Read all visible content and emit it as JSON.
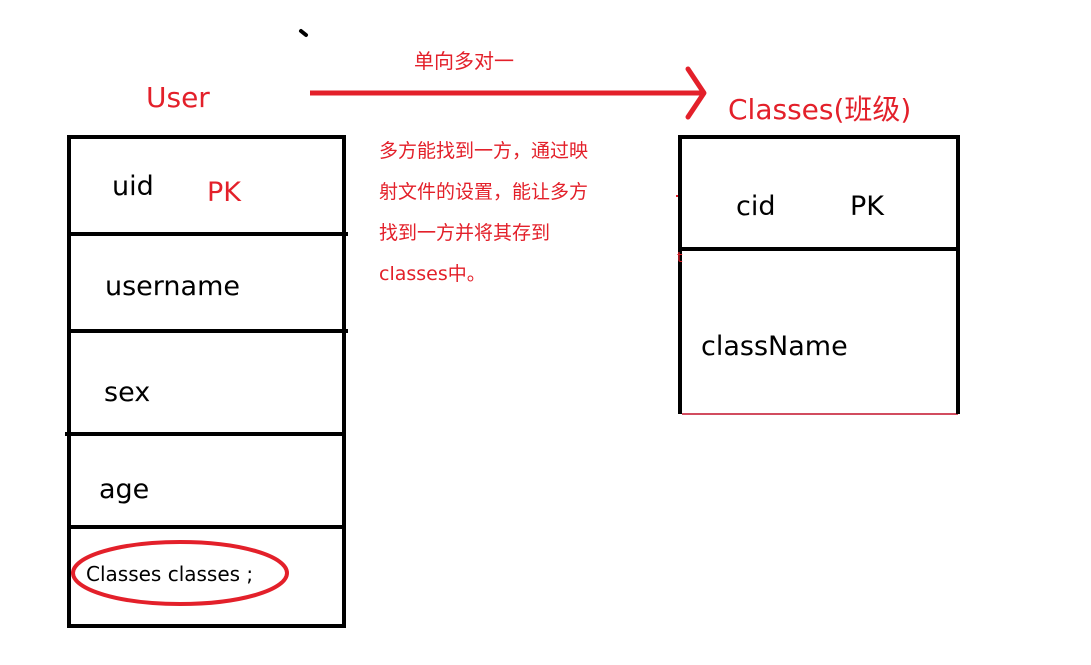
{
  "relation": {
    "label": "单向多对一",
    "note_lines": [
      "多方能找到一方，通过映",
      "射文件的设置，能让多方",
      "找到一方并将其存到",
      "classes中。"
    ]
  },
  "user_entity": {
    "title": "User",
    "fields": [
      {
        "name": "uid",
        "tag": "PK"
      },
      {
        "name": "username"
      },
      {
        "name": "sex"
      },
      {
        "name": "age"
      },
      {
        "name": "Classes classes ;",
        "highlighted": true
      }
    ]
  },
  "classes_entity": {
    "title": "Classes(班级)",
    "fields": [
      {
        "name": "cid",
        "tag": "PK"
      },
      {
        "name": "className"
      }
    ]
  },
  "stray_marks": {
    "classes_left_mark": "t"
  },
  "colors": {
    "accent": "#e3202a",
    "line": "#000000"
  }
}
